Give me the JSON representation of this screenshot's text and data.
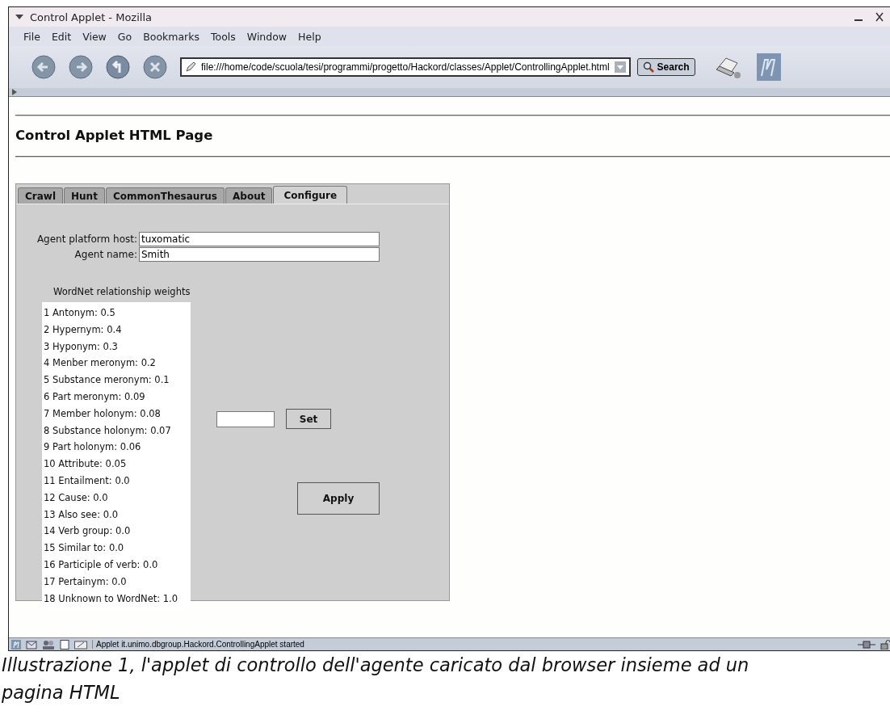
{
  "window": {
    "title": "Control Applet - Mozilla"
  },
  "menu": [
    {
      "label": "File"
    },
    {
      "label": "Edit"
    },
    {
      "label": "View"
    },
    {
      "label": "Go"
    },
    {
      "label": "Bookmarks"
    },
    {
      "label": "Tools"
    },
    {
      "label": "Window"
    },
    {
      "label": "Help"
    }
  ],
  "address": {
    "value": "file:///home/code/scuola/tesi/programmi/progetto/Hackord/classes/Applet/ControllingApplet.html"
  },
  "search_button": "Search",
  "page": {
    "heading": "Control Applet HTML Page"
  },
  "applet": {
    "tabs": [
      {
        "label": "Crawl",
        "selected": false
      },
      {
        "label": "Hunt",
        "selected": false
      },
      {
        "label": "CommonThesaurus",
        "selected": false
      },
      {
        "label": "About",
        "selected": false
      },
      {
        "label": "Configure",
        "selected": true
      }
    ],
    "fields": [
      {
        "label": "Agent platform host:",
        "value": "tuxomatic"
      },
      {
        "label": "Agent name:",
        "value": "Smith"
      }
    ],
    "weights_label": "WordNet relationship weights",
    "weights": [
      "1 Antonym: 0.5",
      "2 Hypernym: 0.4",
      "3 Hyponym: 0.3",
      "4 Menber meronym: 0.2",
      "5 Substance meronym: 0.1",
      "6 Part meronym: 0.09",
      "7 Member holonym: 0.08",
      "8 Substance holonym: 0.07",
      "9 Part holonym: 0.06",
      "10 Attribute: 0.05",
      "11 Entailment: 0.0",
      "12 Cause: 0.0",
      "13 Also see: 0.0",
      "14 Verb group: 0.0",
      "15 Similar to: 0.0",
      "16 Participle of verb: 0.0",
      "17 Pertainym: 0.0",
      "18 Unknown to WordNet: 1.0"
    ],
    "set_button": "Set",
    "apply_button": "Apply"
  },
  "status_bar": {
    "text": "Applet it.unimo.dbgroup.Hackord.ControllingApplet started"
  },
  "caption": [
    "Illustrazione 1, l'applet di controllo dell'agente caricato dal browser insieme ad un",
    "pagina HTML"
  ]
}
